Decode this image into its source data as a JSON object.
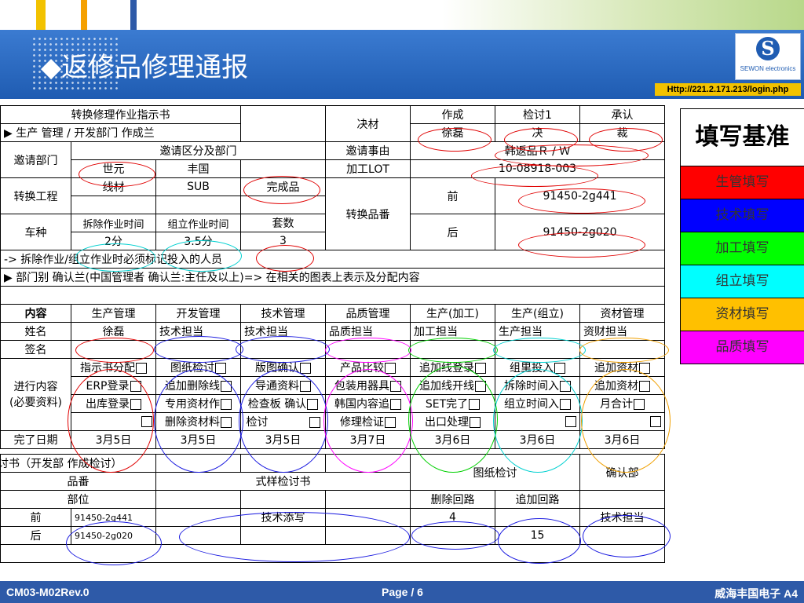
{
  "slide": {
    "title": "◆返修品修理通报",
    "url": "Http://221.2.171.213/login.php",
    "logo_text": "SEWON electronics",
    "logo_mark": "S",
    "footer_left": "CM03-M02Rev.0",
    "footer_center": "Page / 6",
    "footer_right": "威海丰国电子 A4",
    "colors": {
      "header": "#1f5cb2",
      "footer": "#2e5aa8",
      "url_bg": "#f2c200"
    }
  },
  "form": {
    "title": "转换修理作业指示书",
    "dept_line": "▶ 生产 管理 / 开发部门 作成兰",
    "decision": "决材",
    "made": "作成",
    "review1": "检讨1",
    "approve": "承认",
    "made_name": "徐磊",
    "review1_name": "决",
    "approve_name": "裁",
    "req_dept": "邀请部门",
    "req_section": "邀请区分及部门",
    "req_item_label": "邀请事由",
    "req_item_value": "韩返品Ｒ / Ｗ",
    "dept1": "世元",
    "dept2": "丰国",
    "lot_label": "加工LOT",
    "lot_value": "10-08918-003",
    "process_label": "转换工程",
    "process1": "线材",
    "process2": "SUB",
    "process3": "完成品",
    "part_label": "转换品番",
    "before": "前",
    "before_value": "91450-2g441",
    "after": "后",
    "after_value": "91450-2g020",
    "model_label": "车种",
    "teardown_time": "拆除作业时间",
    "assembly_time": "组立作业时间",
    "sets": "套数",
    "teardown_value": "2分",
    "assembly_value": "3.5分",
    "sets_value": "3",
    "note1": "-> 拆除作业/组立作业时必须标记投入的人员",
    "note2": "▶ 部门别 确认兰(中国管理者 确认兰:主任及以上)=> 在相关的图表上表示及分配内容",
    "columns": [
      "内容",
      "生产管理",
      "开发管理",
      "技术管理",
      "品质管理",
      "生产(加工)",
      "生产(组立)",
      "资材管理"
    ],
    "name_label": "姓名",
    "names": [
      "徐磊",
      "技术担当",
      "技术担当",
      "品质担当",
      "加工担当",
      "生产担当",
      "资财担当"
    ],
    "sign_label": "签名",
    "progress_label": "进行内容\n(必要资料)",
    "progress_rows": [
      [
        "指示书分配",
        "图纸检讨",
        "版图确认",
        "产品比较",
        "追加线登录",
        "组里投入",
        "追加资材"
      ],
      [
        "ERP登录",
        "追加删除线",
        "导通资料",
        "包装用器具",
        "追加线开线",
        "拆除时间入",
        "追加资材"
      ],
      [
        "出库登录",
        "专用资材作",
        "检查板 确认",
        "韩国内容追",
        "SET完了",
        "组立时间入",
        "月合计"
      ],
      [
        "",
        "删除资材料",
        "检讨",
        "修理检证",
        "出口处理",
        "",
        ""
      ]
    ],
    "done_label": "完了日期",
    "done_dates": [
      "3月5日",
      "3月5日",
      "3月5日",
      "3月7日",
      "3月6日",
      "3月6日",
      "3月6日"
    ],
    "lower_title": "讨书（开发部 作成检讨）",
    "lower_part": "品番",
    "lower_sample": "式样检讨书",
    "lower_drawing": "图纸检讨",
    "lower_confirm": "确认部",
    "lower_pos": "部位",
    "lower_del": "删除回路",
    "lower_add": "追加回路",
    "lower_before": "前",
    "lower_before_part": "91450-2g441",
    "lower_before_tech": "技术添写",
    "lower_before_del": "4",
    "lower_before_confirm": "技术担当",
    "lower_after": "后",
    "lower_after_part": "91450-2g020",
    "lower_after_add": "15"
  },
  "legend": {
    "title": "填写基准",
    "items": [
      {
        "label": "生管填写",
        "color": "#ff0000"
      },
      {
        "label": "技术填写",
        "color": "#0000ff"
      },
      {
        "label": "加工填写",
        "color": "#00ff00"
      },
      {
        "label": "组立填写",
        "color": "#00ffff"
      },
      {
        "label": "资材填写",
        "color": "#ffc000"
      },
      {
        "label": "品质填写",
        "color": "#ff00ff"
      }
    ]
  }
}
